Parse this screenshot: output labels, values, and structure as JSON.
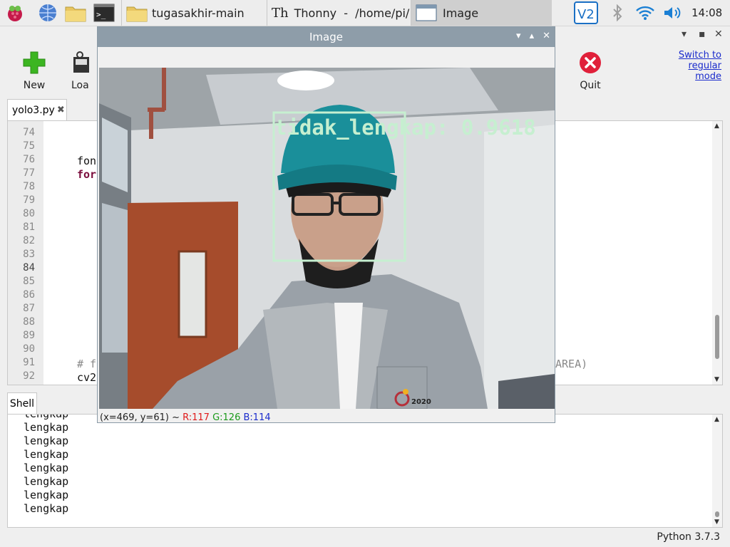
{
  "taskbar": {
    "folder_task": "tugasakhir-main",
    "thonny_task": "Thonny  -  /home/pi/…",
    "image_task": "Image",
    "clock": "14:08"
  },
  "toolbar": {
    "new_label": "New",
    "load_label": "Loa",
    "quit_label": "Quit",
    "switch_mode": "Switch to regular mode"
  },
  "editor": {
    "tab_name": "yolo3.py",
    "line_numbers": [
      "74",
      "75",
      "76",
      "77",
      "78",
      "79",
      "80",
      "81",
      "82",
      "83",
      "84",
      "85",
      "86",
      "87",
      "88",
      "89",
      "90",
      "91",
      "92"
    ],
    "current_line": "84",
    "code_fon": "fon",
    "code_for": "for",
    "code_comment": "# f",
    "code_comment_tail": "AREA)",
    "code_cv2": "cv2"
  },
  "shell": {
    "tab_name": "Shell",
    "lines": [
      "lengkap",
      "lengkap",
      "lengkap",
      "lengkap",
      "lengkap",
      "lengkap",
      "lengkap",
      "lengkap"
    ]
  },
  "status": {
    "python_version": "Python 3.7.3"
  },
  "image_window": {
    "title": "Image",
    "detection_label": "tidak_lengkap: 0.9618",
    "pixel_coords": "(x=469, y=61) ~",
    "r_value": "R:117",
    "g_value": "G:126",
    "b_value": "B:114",
    "logo_text": "2020"
  },
  "colors": {
    "detection_box": "#c6efd0",
    "quit_red": "#e0203a",
    "new_green": "#3cb521",
    "link_blue": "#1a2bcc"
  }
}
